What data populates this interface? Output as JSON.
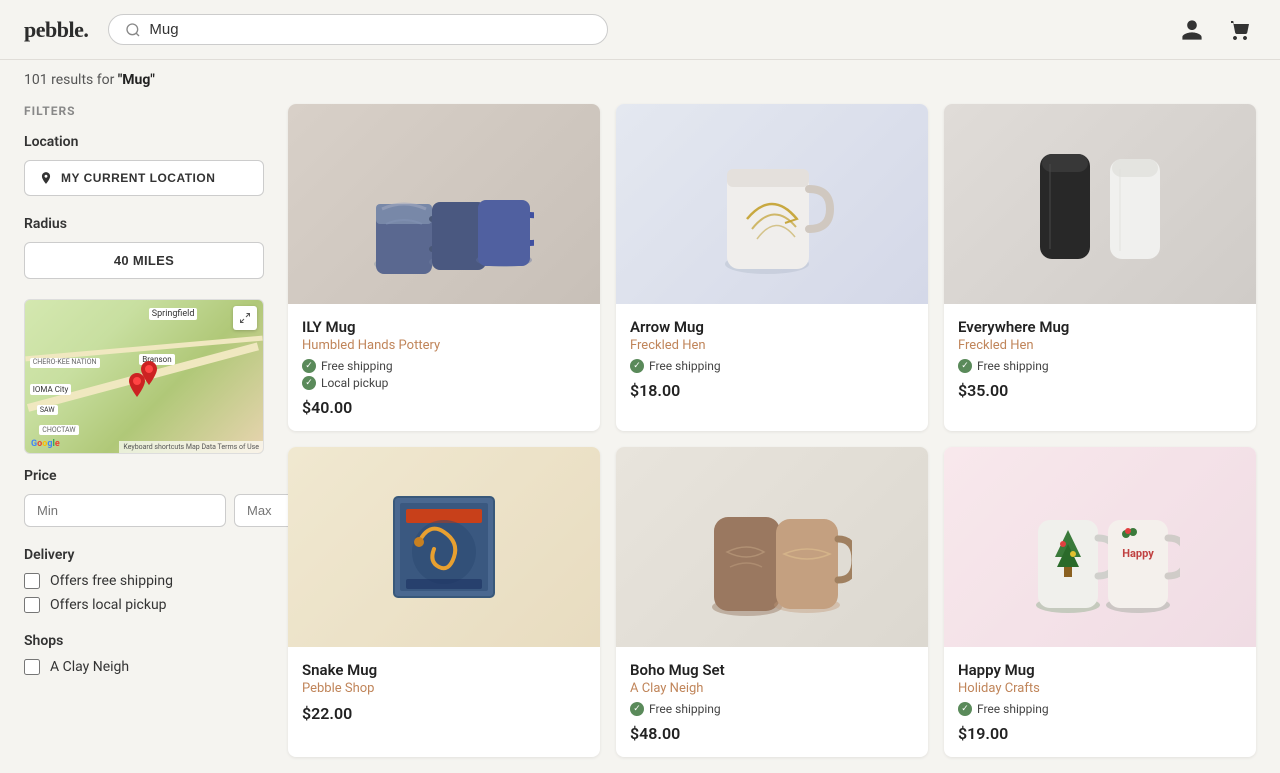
{
  "header": {
    "logo": "pebble.",
    "search_placeholder": "Mug",
    "search_value": "Mug"
  },
  "results": {
    "count": "101",
    "query": "\"Mug\"",
    "label": "101 results for"
  },
  "filters": {
    "title": "FILTERS",
    "location": {
      "label": "Location",
      "button_text": "MY CURRENT LOCATION"
    },
    "radius": {
      "label": "Radius",
      "value": "40 MILES"
    },
    "price": {
      "label": "Price",
      "min_placeholder": "Min",
      "max_placeholder": "Max"
    },
    "delivery": {
      "label": "Delivery",
      "options": [
        {
          "id": "free-shipping",
          "label": "Offers free shipping",
          "checked": false
        },
        {
          "id": "local-pickup",
          "label": "Offers local pickup",
          "checked": false
        }
      ]
    },
    "shops": {
      "label": "Shops",
      "options": [
        {
          "id": "clay-neigh",
          "label": "A Clay Neigh",
          "checked": false
        }
      ]
    },
    "map": {
      "labels": {
        "springfield": "Springfield",
        "branson": "Branson",
        "ioma_city": "IOMA City",
        "saw": "SAW",
        "cherokee": "CHERO-KEE NATION",
        "choctaw": "CHOCTAW"
      },
      "footer": "Keyboard shortcuts  Map Data  Terms of Use"
    }
  },
  "products": [
    {
      "id": "ily-mug",
      "name": "ILY Mug",
      "shop": "Humbled Hands Pottery",
      "price": "$40.00",
      "free_shipping": true,
      "local_pickup": true,
      "bg_class": "bg-marble",
      "emoji": "🏺"
    },
    {
      "id": "arrow-mug",
      "name": "Arrow Mug",
      "shop": "Freckled Hen",
      "price": "$18.00",
      "free_shipping": true,
      "local_pickup": false,
      "bg_class": "bg-light-blue",
      "emoji": "☕"
    },
    {
      "id": "everywhere-mug",
      "name": "Everywhere Mug",
      "shop": "Freckled Hen",
      "price": "$35.00",
      "free_shipping": true,
      "local_pickup": false,
      "bg_class": "bg-marble",
      "emoji": "🥤"
    },
    {
      "id": "snake-mug",
      "name": "Snake Mug",
      "shop": "Pebble Shop",
      "price": "$22.00",
      "free_shipping": false,
      "local_pickup": false,
      "bg_class": "bg-warm",
      "emoji": "🐍"
    },
    {
      "id": "boho-mug",
      "name": "Boho Mug Set",
      "shop": "A Clay Neigh",
      "price": "$48.00",
      "free_shipping": true,
      "local_pickup": false,
      "bg_class": "bg-cream",
      "emoji": "☕"
    },
    {
      "id": "christmas-mug",
      "name": "Happy Mug",
      "shop": "Holiday Crafts",
      "price": "$19.00",
      "free_shipping": true,
      "local_pickup": false,
      "bg_class": "bg-pink",
      "emoji": "🎄"
    }
  ],
  "badges": {
    "free_shipping": "Free shipping",
    "local_pickup": "Local pickup"
  }
}
